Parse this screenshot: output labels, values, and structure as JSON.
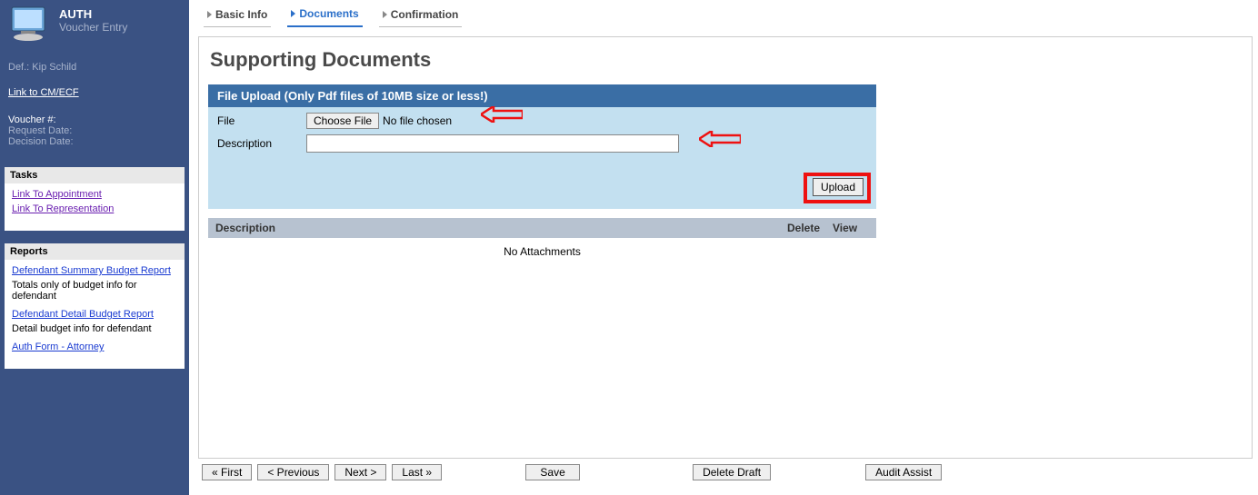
{
  "sidebar": {
    "title": "AUTH",
    "subtitle": "Voucher Entry",
    "def_prefix": "Def.:",
    "def_name": "Kip Schild",
    "link_cmecf": "Link to CM/ECF",
    "voucher_label": "Voucher #:",
    "request_date_label": "Request Date:",
    "decision_date_label": "Decision Date:",
    "tasks": {
      "header": "Tasks",
      "items": [
        {
          "label": "Link To Appointment"
        },
        {
          "label": "Link To Representation"
        }
      ]
    },
    "reports": {
      "header": "Reports",
      "items": [
        {
          "label": "Defendant Summary Budget Report",
          "desc": "Totals only of budget info for defendant"
        },
        {
          "label": "Defendant Detail Budget Report",
          "desc": "Detail budget info for defendant"
        },
        {
          "label": "Auth Form - Attorney",
          "desc": ""
        }
      ]
    }
  },
  "tabs": [
    {
      "label": "Basic Info",
      "active": false
    },
    {
      "label": "Documents",
      "active": true
    },
    {
      "label": "Confirmation",
      "active": false
    }
  ],
  "page_title": "Supporting Documents",
  "upload": {
    "title": "File Upload (Only Pdf files of 10MB size or less!)",
    "file_label": "File",
    "choose_btn": "Choose File",
    "file_status": "No file chosen",
    "desc_label": "Description",
    "upload_btn": "Upload"
  },
  "table": {
    "col_desc": "Description",
    "col_delete": "Delete",
    "col_view": "View",
    "empty": "No Attachments"
  },
  "buttons": {
    "first": "« First",
    "prev": "< Previous",
    "next": "Next >",
    "last": "Last »",
    "save": "Save",
    "delete_draft": "Delete Draft",
    "audit": "Audit Assist"
  }
}
